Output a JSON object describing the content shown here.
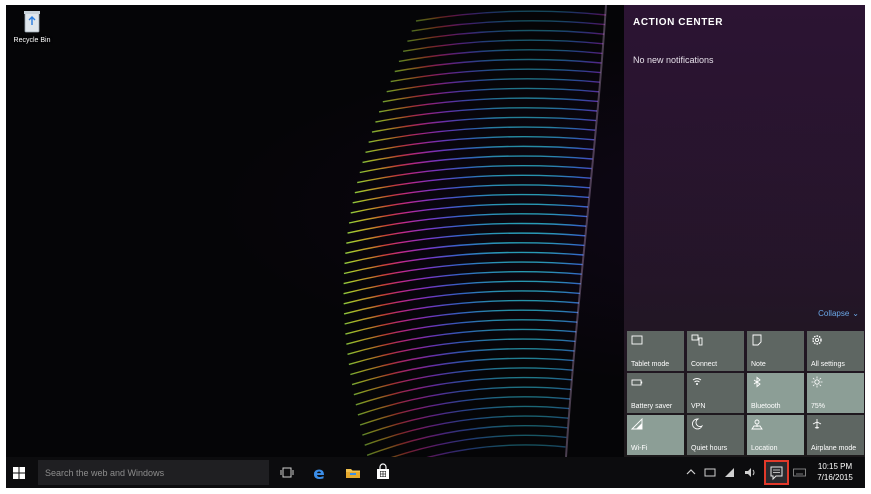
{
  "desktop": {
    "icons": [
      {
        "label": "Recycle Bin",
        "icon": "recycle-bin-icon"
      }
    ]
  },
  "action_center": {
    "title": "ACTION CENTER",
    "empty_message": "No new notifications",
    "collapse_label": "Collapse",
    "accent_color": "#6aa8e8",
    "quick_actions": [
      {
        "label": "Tablet mode",
        "icon": "tablet-mode-icon",
        "on": false
      },
      {
        "label": "Connect",
        "icon": "connect-icon",
        "on": false
      },
      {
        "label": "Note",
        "icon": "note-icon",
        "on": false
      },
      {
        "label": "All settings",
        "icon": "settings-gear-icon",
        "on": false
      },
      {
        "label": "Battery saver",
        "icon": "battery-saver-icon",
        "on": false
      },
      {
        "label": "VPN",
        "icon": "vpn-icon",
        "on": false
      },
      {
        "label": "Bluetooth",
        "icon": "bluetooth-icon",
        "on": true
      },
      {
        "label": "75%",
        "icon": "brightness-icon",
        "on": true
      },
      {
        "label": "Wi-Fi",
        "icon": "wifi-icon",
        "on": true
      },
      {
        "label": "Quiet hours",
        "icon": "quiet-hours-moon-icon",
        "on": false
      },
      {
        "label": "Location",
        "icon": "location-icon",
        "on": true
      },
      {
        "label": "Airplane mode",
        "icon": "airplane-icon",
        "on": false
      }
    ]
  },
  "taskbar": {
    "search_placeholder": "Search the web and Windows",
    "clock_time": "10:15 PM",
    "clock_date": "7/16/2015",
    "highlight_color": "#e2392a"
  }
}
